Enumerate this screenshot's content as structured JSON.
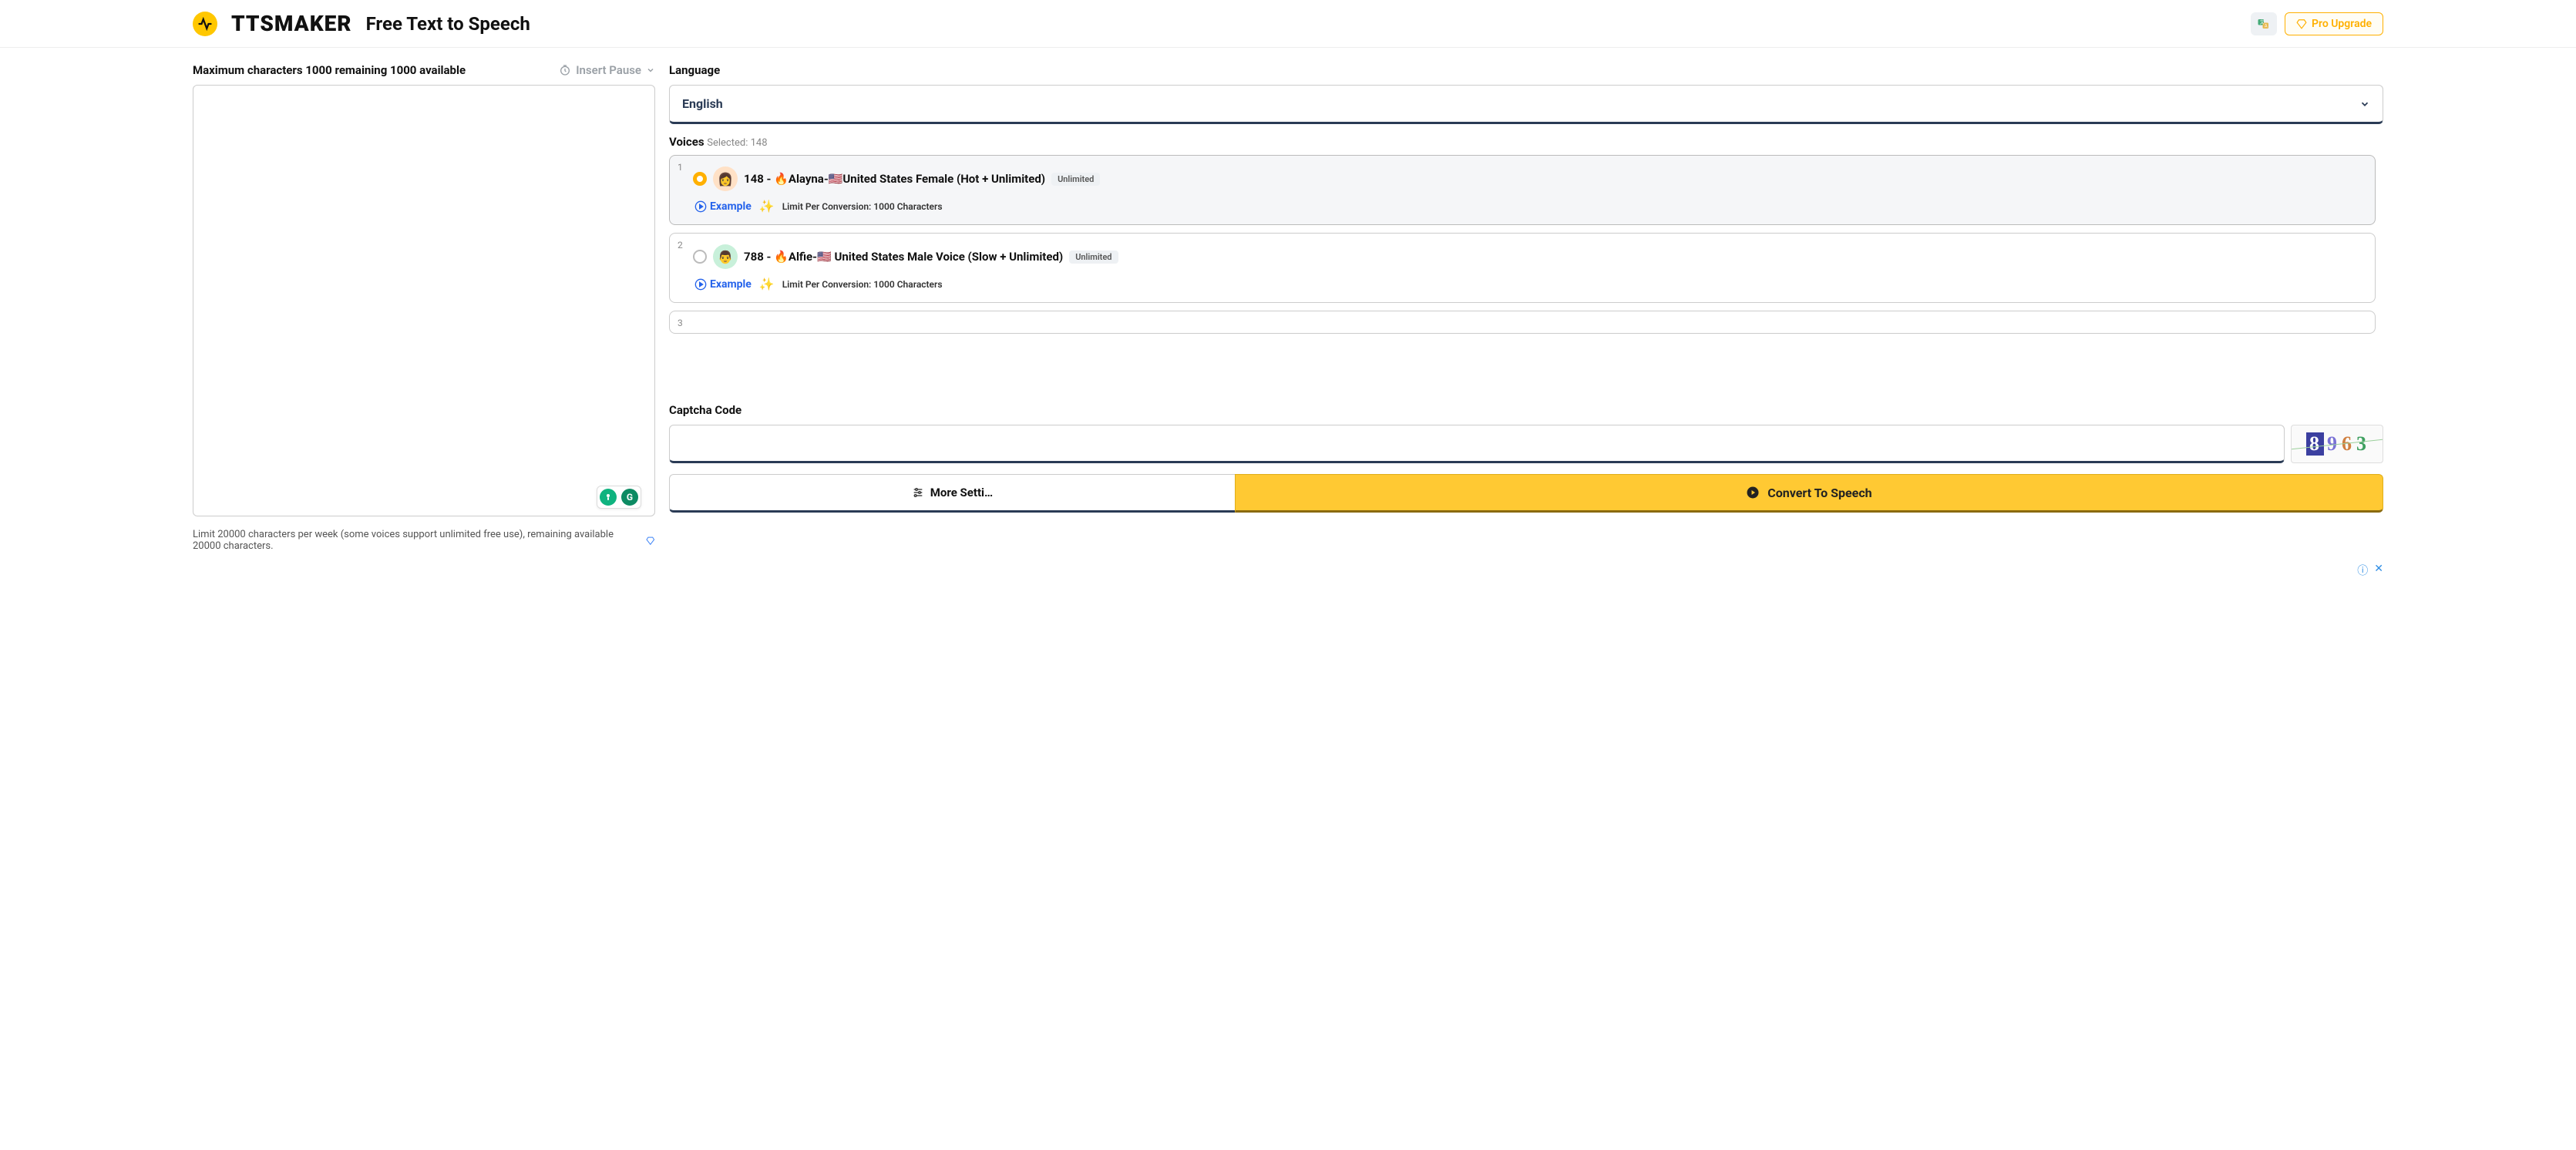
{
  "header": {
    "brand": "TTSMAKER",
    "tagline": "Free Text to Speech",
    "pro_label": "Pro Upgrade"
  },
  "editor": {
    "char_info": "Maximum characters 1000 remaining 1000 available",
    "insert_pause": "Insert Pause",
    "textarea_value": "",
    "weekly_info": "Limit 20000 characters per week (some voices support unlimited free use), remaining available 20000 characters."
  },
  "language": {
    "label": "Language",
    "selected": "English"
  },
  "voices": {
    "label_prefix": "Voices",
    "selected_label": "Selected: 148",
    "items": [
      {
        "idx": "1",
        "selected": true,
        "avatar": "👩",
        "title": "148 - 🔥Alayna-🇺🇸United States Female (Hot + Unlimited)",
        "badge": "Unlimited",
        "example": "Example",
        "limit": "Limit Per Conversion: 1000 Characters"
      },
      {
        "idx": "2",
        "selected": false,
        "avatar": "👨",
        "title": "788 - 🔥Alfie-🇺🇸 United States Male Voice (Slow + Unlimited)",
        "badge": "Unlimited",
        "example": "Example",
        "limit": "Limit Per Conversion: 1000 Characters"
      },
      {
        "idx": "3",
        "selected": false,
        "avatar": "",
        "title": "",
        "badge": "",
        "example": "",
        "limit": ""
      }
    ]
  },
  "captcha": {
    "label": "Captcha Code",
    "value": "",
    "digits": [
      "8",
      "9",
      "6",
      "3"
    ]
  },
  "actions": {
    "more": "More Setti…",
    "convert": "Convert To Speech"
  }
}
